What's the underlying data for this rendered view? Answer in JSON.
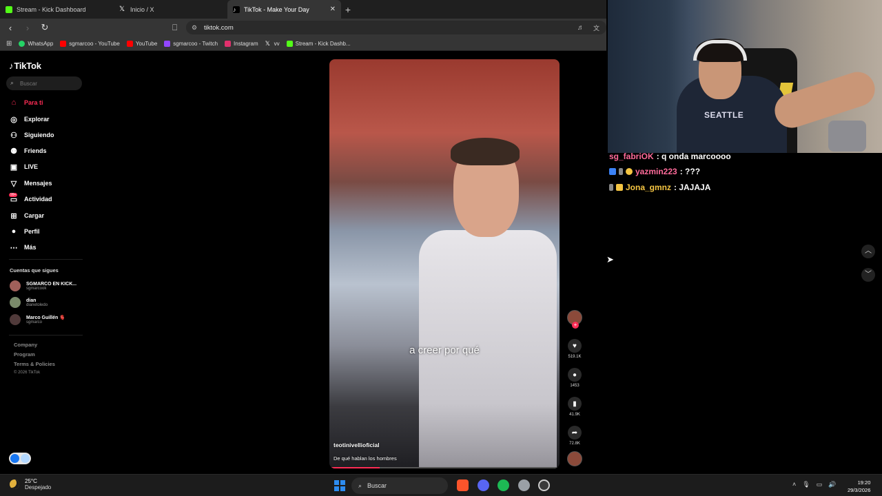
{
  "browser": {
    "tabs": [
      {
        "title": "Stream - Kick Dashboard",
        "favicon_color": "#53fc18",
        "active": false
      },
      {
        "title": "Inicio / X",
        "favicon_color": "#ffffff",
        "active": false
      },
      {
        "title": "TikTok - Make Your Day",
        "favicon_color": "#ffffff",
        "active": true
      }
    ],
    "new_tab_label": "+",
    "url": "tiktok.com",
    "bookmarks": [
      {
        "label": "WhatsApp",
        "icon_color": "#25d366"
      },
      {
        "label": "sgmarcoo - YouTube",
        "icon_color": "#ff0000"
      },
      {
        "label": "YouTube",
        "icon_color": "#ff0000"
      },
      {
        "label": "sgmarcoo - Twitch",
        "icon_color": "#9146ff"
      },
      {
        "label": "Instagram",
        "icon_color": "#e1306c"
      },
      {
        "label": "vv",
        "icon_color": "#ffffff"
      },
      {
        "label": "Stream - Kick Dashb...",
        "icon_color": "#53fc18"
      }
    ]
  },
  "tiktok": {
    "logo": "TikTok",
    "search_placeholder": "Buscar",
    "nav": [
      {
        "label": "Para ti",
        "icon": "home-icon"
      },
      {
        "label": "Explorar",
        "icon": "compass-icon"
      },
      {
        "label": "Siguiendo",
        "icon": "following-icon"
      },
      {
        "label": "Friends",
        "icon": "friends-icon"
      },
      {
        "label": "LIVE",
        "icon": "live-icon"
      },
      {
        "label": "Mensajes",
        "icon": "messages-icon"
      },
      {
        "label": "Actividad",
        "icon": "activity-icon"
      },
      {
        "label": "Cargar",
        "icon": "upload-icon"
      },
      {
        "label": "Perfil",
        "icon": "profile-icon"
      },
      {
        "label": "Más",
        "icon": "more-icon"
      }
    ],
    "activity_badge": "99+",
    "following_header": "Cuentas que sigues",
    "following": [
      {
        "name": "SGMARCO EN KICK...",
        "handle": "sgmarcook",
        "avatar_color": "#a0605a"
      },
      {
        "name": "dian",
        "handle": "dianetoledo",
        "avatar_color": "#7a8a6a"
      },
      {
        "name": "Marco Guillén 🫀",
        "handle": "sgmarco",
        "avatar_color": "#503a3a"
      }
    ],
    "footer": [
      "Company",
      "Program",
      "Terms & Policies"
    ],
    "copyright": "© 2026 TikTok",
    "video": {
      "subtitle": "a creer por qué",
      "author": "teotinivellioficial",
      "description": "De qué hablan los hombres",
      "progress": 0.22
    },
    "actions": {
      "likes": "519.1K",
      "comments": "1453",
      "saves": "41.9K",
      "shares": "72.8K"
    }
  },
  "webcam": {
    "shirt_text": "SEATTLE"
  },
  "chat": [
    {
      "user": "sg_fabriOK",
      "text": ": q onda marcoooo",
      "user_color": "#ff6b9a"
    },
    {
      "user": "yazmin223",
      "text": ": ???",
      "user_color": "#ff6b9a"
    },
    {
      "user": "Jona_gmnz",
      "text": ": JAJAJA",
      "user_color": "#f5c542"
    }
  ],
  "taskbar": {
    "temperature": "25°C",
    "weather": "Despejado",
    "search_label": "Buscar",
    "time": "19:20",
    "date": "29/3/2026"
  }
}
